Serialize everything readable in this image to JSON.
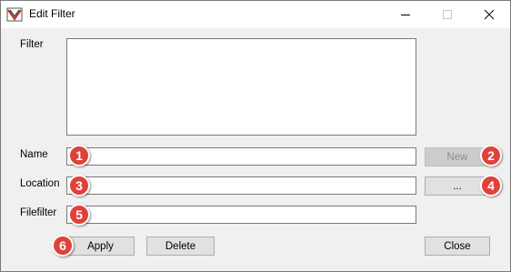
{
  "window": {
    "title": "Edit Filter"
  },
  "form": {
    "filter_label": "Filter",
    "filter_value": "",
    "name_label": "Name",
    "name_value": "",
    "location_label": "Location",
    "location_value": "",
    "filefilter_label": "Filefilter",
    "filefilter_value": ""
  },
  "buttons": {
    "new": "New",
    "browse": "...",
    "apply": "Apply",
    "delete": "Delete",
    "close": "Close"
  },
  "annotations": [
    "1",
    "2",
    "3",
    "4",
    "5",
    "6"
  ],
  "colors": {
    "badge": "#e0413a",
    "window_bg": "#f0f0f0",
    "titlebar_bg": "#ffffff"
  }
}
